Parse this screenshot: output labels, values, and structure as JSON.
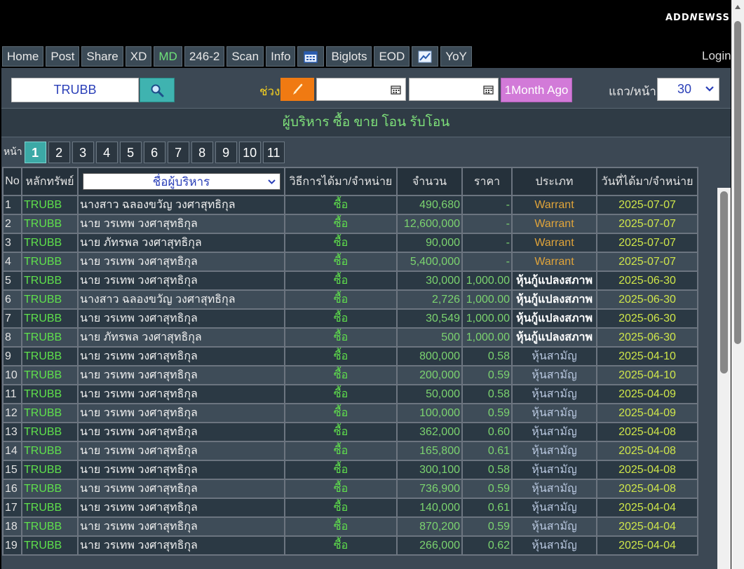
{
  "header": {
    "logo_a": "ADD",
    "logo_n": "N",
    "logo_b": "EWSS"
  },
  "nav": {
    "items": [
      {
        "label": "Home"
      },
      {
        "label": "Post"
      },
      {
        "label": "Share"
      },
      {
        "label": "XD"
      },
      {
        "label": "MD"
      },
      {
        "label": "246-2"
      },
      {
        "label": "Scan"
      },
      {
        "label": "Info"
      },
      {
        "icon": "calendar-icon"
      },
      {
        "label": "Biglots"
      },
      {
        "label": "EOD"
      },
      {
        "icon": "chart-icon"
      },
      {
        "label": "YoY"
      }
    ],
    "active": "MD",
    "login": "Login"
  },
  "search": {
    "symbol": "TRUBB",
    "range_label": "ช่วง",
    "month_button": "1Month Ago",
    "rows_label": "แถว/หน้า",
    "rows_value": "30"
  },
  "section_title": "ผู้บริหาร ซื้อ ขาย โอน รับโอน",
  "pager": {
    "label": "หน้า",
    "pages": [
      "1",
      "2",
      "3",
      "4",
      "5",
      "6",
      "7",
      "8",
      "9",
      "10",
      "11"
    ],
    "current": "1"
  },
  "table": {
    "headers": {
      "no": "No",
      "symbol": "หลักทรัพย์",
      "name_filter": "ชื่อผู้บริหาร",
      "method": "วิธีการได้มา/จำหน่าย",
      "qty": "จำนวน",
      "price": "ราคา",
      "type": "ประเภท",
      "date": "วันที่ได้มา/จำหน่าย"
    },
    "rows": [
      {
        "no": "1",
        "symbol": "TRUBB",
        "name": "นางสาว ฉลองขวัญ วงศาสุทธิกุล",
        "method": "ซื้อ",
        "qty": "490,680",
        "price": "-",
        "type": "Warrant",
        "kind": "warrant",
        "date": "2025-07-07"
      },
      {
        "no": "2",
        "symbol": "TRUBB",
        "name": "นาย วรเทพ วงศาสุทธิกุล",
        "method": "ซื้อ",
        "qty": "12,600,000",
        "price": "-",
        "type": "Warrant",
        "kind": "warrant",
        "date": "2025-07-07"
      },
      {
        "no": "3",
        "symbol": "TRUBB",
        "name": "นาย ภัทรพล วงศาสุทธิกุล",
        "method": "ซื้อ",
        "qty": "90,000",
        "price": "-",
        "type": "Warrant",
        "kind": "warrant",
        "date": "2025-07-07"
      },
      {
        "no": "4",
        "symbol": "TRUBB",
        "name": "นาย วรเทพ วงศาสุทธิกุล",
        "method": "ซื้อ",
        "qty": "5,400,000",
        "price": "-",
        "type": "Warrant",
        "kind": "warrant",
        "date": "2025-07-07"
      },
      {
        "no": "5",
        "symbol": "TRUBB",
        "name": "นาย วรเทพ วงศาสุทธิกุล",
        "method": "ซื้อ",
        "qty": "30,000",
        "price": "1,000.00",
        "type": "หุ้นกู้แปลงสภาพ",
        "kind": "conv",
        "date": "2025-06-30"
      },
      {
        "no": "6",
        "symbol": "TRUBB",
        "name": "นางสาว ฉลองขวัญ วงศาสุทธิกุล",
        "method": "ซื้อ",
        "qty": "2,726",
        "price": "1,000.00",
        "type": "หุ้นกู้แปลงสภาพ",
        "kind": "conv",
        "date": "2025-06-30"
      },
      {
        "no": "7",
        "symbol": "TRUBB",
        "name": "นาย วรเทพ วงศาสุทธิกุล",
        "method": "ซื้อ",
        "qty": "30,549",
        "price": "1,000.00",
        "type": "หุ้นกู้แปลงสภาพ",
        "kind": "conv",
        "date": "2025-06-30"
      },
      {
        "no": "8",
        "symbol": "TRUBB",
        "name": "นาย ภัทรพล วงศาสุทธิกุล",
        "method": "ซื้อ",
        "qty": "500",
        "price": "1,000.00",
        "type": "หุ้นกู้แปลงสภาพ",
        "kind": "conv",
        "date": "2025-06-30"
      },
      {
        "no": "9",
        "symbol": "TRUBB",
        "name": "นาย วรเทพ วงศาสุทธิกุล",
        "method": "ซื้อ",
        "qty": "800,000",
        "price": "0.58",
        "type": "หุ้นสามัญ",
        "kind": "common",
        "date": "2025-04-10"
      },
      {
        "no": "10",
        "symbol": "TRUBB",
        "name": "นาย วรเทพ วงศาสุทธิกุล",
        "method": "ซื้อ",
        "qty": "200,000",
        "price": "0.59",
        "type": "หุ้นสามัญ",
        "kind": "common",
        "date": "2025-04-10"
      },
      {
        "no": "11",
        "symbol": "TRUBB",
        "name": "นาย วรเทพ วงศาสุทธิกุล",
        "method": "ซื้อ",
        "qty": "50,000",
        "price": "0.58",
        "type": "หุ้นสามัญ",
        "kind": "common",
        "date": "2025-04-09"
      },
      {
        "no": "12",
        "symbol": "TRUBB",
        "name": "นาย วรเทพ วงศาสุทธิกุล",
        "method": "ซื้อ",
        "qty": "100,000",
        "price": "0.59",
        "type": "หุ้นสามัญ",
        "kind": "common",
        "date": "2025-04-09"
      },
      {
        "no": "13",
        "symbol": "TRUBB",
        "name": "นาย วรเทพ วงศาสุทธิกุล",
        "method": "ซื้อ",
        "qty": "362,000",
        "price": "0.60",
        "type": "หุ้นสามัญ",
        "kind": "common",
        "date": "2025-04-08"
      },
      {
        "no": "14",
        "symbol": "TRUBB",
        "name": "นาย วรเทพ วงศาสุทธิกุล",
        "method": "ซื้อ",
        "qty": "165,800",
        "price": "0.61",
        "type": "หุ้นสามัญ",
        "kind": "common",
        "date": "2025-04-08"
      },
      {
        "no": "15",
        "symbol": "TRUBB",
        "name": "นาย วรเทพ วงศาสุทธิกุล",
        "method": "ซื้อ",
        "qty": "300,100",
        "price": "0.58",
        "type": "หุ้นสามัญ",
        "kind": "common",
        "date": "2025-04-08"
      },
      {
        "no": "16",
        "symbol": "TRUBB",
        "name": "นาย วรเทพ วงศาสุทธิกุล",
        "method": "ซื้อ",
        "qty": "736,900",
        "price": "0.59",
        "type": "หุ้นสามัญ",
        "kind": "common",
        "date": "2025-04-08"
      },
      {
        "no": "17",
        "symbol": "TRUBB",
        "name": "นาย วรเทพ วงศาสุทธิกุล",
        "method": "ซื้อ",
        "qty": "140,000",
        "price": "0.61",
        "type": "หุ้นสามัญ",
        "kind": "common",
        "date": "2025-04-04"
      },
      {
        "no": "18",
        "symbol": "TRUBB",
        "name": "นาย วรเทพ วงศาสุทธิกุล",
        "method": "ซื้อ",
        "qty": "870,200",
        "price": "0.59",
        "type": "หุ้นสามัญ",
        "kind": "common",
        "date": "2025-04-04"
      },
      {
        "no": "19",
        "symbol": "TRUBB",
        "name": "นาย วรเทพ วงศาสุทธิกุล",
        "method": "ซื้อ",
        "qty": "266,000",
        "price": "0.62",
        "type": "หุ้นสามัญ",
        "kind": "common",
        "date": "2025-04-04"
      }
    ]
  },
  "colors": {
    "panel_bg": "#3c4854",
    "accent_green": "#5fe04c",
    "warrant": "#e0a43a",
    "date": "#cfe64a",
    "search_btn": "#3fb3b0",
    "brush_btn": "#f07a12",
    "month_btn": "#d27ad8"
  }
}
